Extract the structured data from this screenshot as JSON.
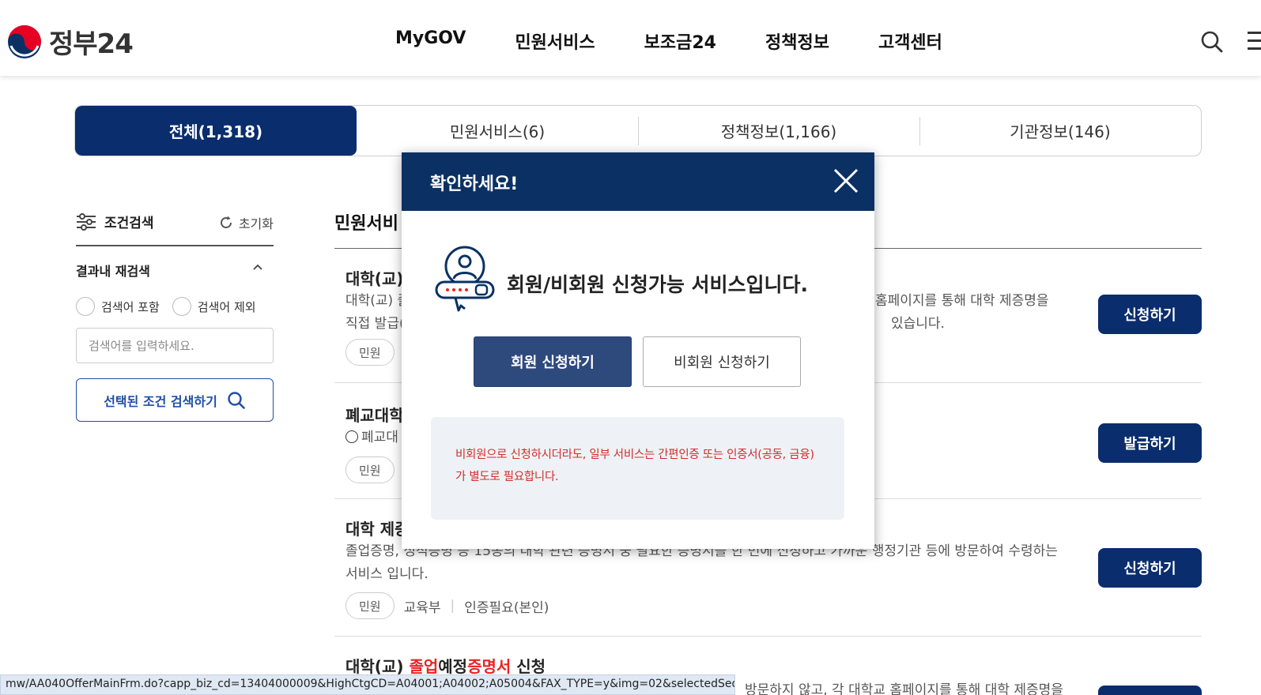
{
  "header": {
    "logo_text": "정부24",
    "nav": [
      "MyGOV",
      "민원서비스",
      "보조금24",
      "정책정보",
      "고객센터"
    ],
    "search_icon": "search-icon",
    "menu_icon": "hamburger-menu-icon"
  },
  "tabs": [
    {
      "label": "전체(1,318)",
      "active": true
    },
    {
      "label": "민원서비스(6)",
      "active": false
    },
    {
      "label": "정책정보(1,166)",
      "active": false
    },
    {
      "label": "기관정보(146)",
      "active": false
    }
  ],
  "filter": {
    "title": "조건검색",
    "reset_label": "초기화",
    "re_search_title": "결과내 재검색",
    "radio_include": "검색어 포함",
    "radio_exclude": "검색어 제외",
    "input_placeholder": "검색어를 입력하세요.",
    "search_button": "선택된 조건 검색하기"
  },
  "list": {
    "title": "민원서비",
    "items": [
      {
        "title": "대학(교)",
        "desc_left": "대학(교) 졸",
        "desc_right": "홈페이지를 통해 대학 제증명을",
        "desc_left2": "직접 발급(",
        "desc_right2": "있습니다.",
        "tag": "민원",
        "button": "신청하기"
      },
      {
        "title": "폐교대학",
        "desc_left": "폐교대",
        "tag": "민원",
        "button": "발급하기"
      },
      {
        "title": "대학 제증",
        "desc": "졸업증명, 성적증명 등 15종의 대학 관련 증명서 중 필요한 증명서를 한 번에 신청하고 가까운 행정기관 등에 방문하여 수령하는 서비스 입니다.",
        "tag": "민원",
        "ministry": "교육부",
        "auth": "인증필요(본인)",
        "button": "신청하기"
      },
      {
        "title_prefix": "대학(교) ",
        "title_red1": "졸업",
        "title_mid": "예정",
        "title_red2": "증명서",
        "title_suffix": " 신청",
        "desc_right": "방문하지 않고, 각 대학교 홈페이지를 통해 대학 제증명을"
      }
    ]
  },
  "status_bar": "mw/AA040OfferMainFrm.do?capp_biz_cd=13404000009&HighCtgCD=A04001;A04002;A05004&FAX_TYPE=y&img=02&selectedSeq=01",
  "modal": {
    "title": "확인하세요!",
    "close_icon": "close-icon",
    "message": "회원/비회원 신청가능 서비스입니다.",
    "member_button": "회원 신청하기",
    "nonmember_button": "비회원 신청하기",
    "notice_line1": "비회원으로 신청하시더라도, 일부 서비스는 간편인증 또는 인증서(공동, 금융)",
    "notice_line2": "가 별도로 필요합니다."
  },
  "colors": {
    "primary_navy": "#0a2d6e",
    "modal_header": "#0b3164",
    "notice_red": "#d62b2b"
  }
}
